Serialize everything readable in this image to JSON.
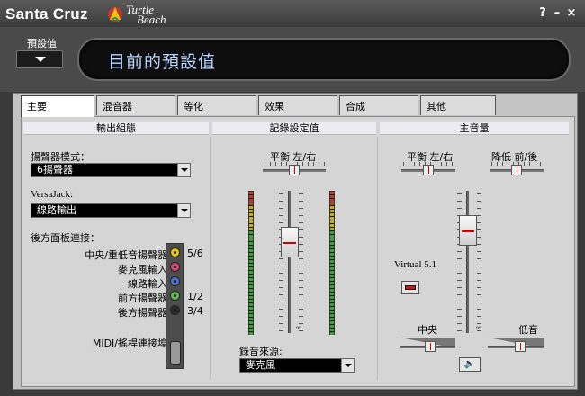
{
  "app": {
    "brand": "Santa Cruz",
    "logo_line1": "Turtle",
    "logo_line2": "Beach",
    "help": "?",
    "minimize": "–",
    "close": "×"
  },
  "preset": {
    "label": "預設值",
    "current": "目前的預設值"
  },
  "tabs": [
    {
      "label": "主要",
      "active": true
    },
    {
      "label": "混音器"
    },
    {
      "label": "等化"
    },
    {
      "label": "效果"
    },
    {
      "label": "合成"
    },
    {
      "label": "其他"
    }
  ],
  "output": {
    "header": "輸出組態",
    "speaker_mode_label": "揚聲器模式：",
    "speaker_mode_value": "6揚聲器",
    "versajack_label": "VersaJack:",
    "versajack_value": "線路輸出",
    "rear_panel_label": "後方面板連接：",
    "connections": [
      {
        "label": "中央/重低音揚聲器",
        "value": "5/6",
        "color": "#e8c800"
      },
      {
        "label": "麥克風輸入",
        "value": "",
        "color": "#d7477a"
      },
      {
        "label": "線路輸入",
        "value": "",
        "color": "#4a74d0"
      },
      {
        "label": "前方揚聲器",
        "value": "1/2",
        "color": "#5fbf4e"
      },
      {
        "label": "後方揚聲器",
        "value": "3/4",
        "color": "#2c2c2c"
      }
    ],
    "midi_label": "MIDI/搖桿連接埠"
  },
  "record": {
    "header": "記錄設定值",
    "balance_label": "平衡 左/右",
    "balance_value": 0.5,
    "volume_level": 0.68,
    "infinity": "∞",
    "source_label": "錄音來源:",
    "source_value": "麥克風"
  },
  "master": {
    "header": "主音量",
    "balance_label": "平衡 左/右",
    "fade_label": "降低 前/後",
    "balance_value": 0.5,
    "fade_value": 0.5,
    "volume_level": 0.78,
    "virtual_label": "Virtual 5.1",
    "center_label": "中央",
    "sub_label": "低音",
    "center_value": 0.55,
    "sub_value": 0.6,
    "infinity": "∞",
    "mute_icon": "🔈"
  }
}
